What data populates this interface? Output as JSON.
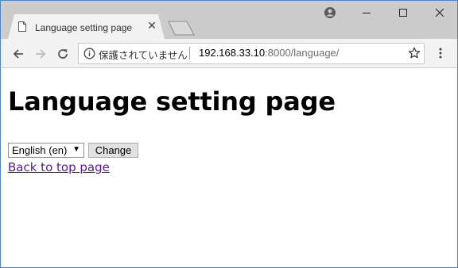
{
  "browser": {
    "tab_title": "Language setting page",
    "tab_close": "✕",
    "security_label": "保護されていません",
    "url_host": "192.168.33.10",
    "url_rest": ":8000/language/"
  },
  "page": {
    "heading": "Language setting page",
    "language_select": {
      "selected": "English (en)",
      "arrow": "▼"
    },
    "change_button": "Change",
    "back_link": "Back to top page"
  },
  "colors": {
    "titlebar": "#cccccc",
    "toolbar": "#f2f2f2",
    "visited_link": "#551a8b"
  }
}
